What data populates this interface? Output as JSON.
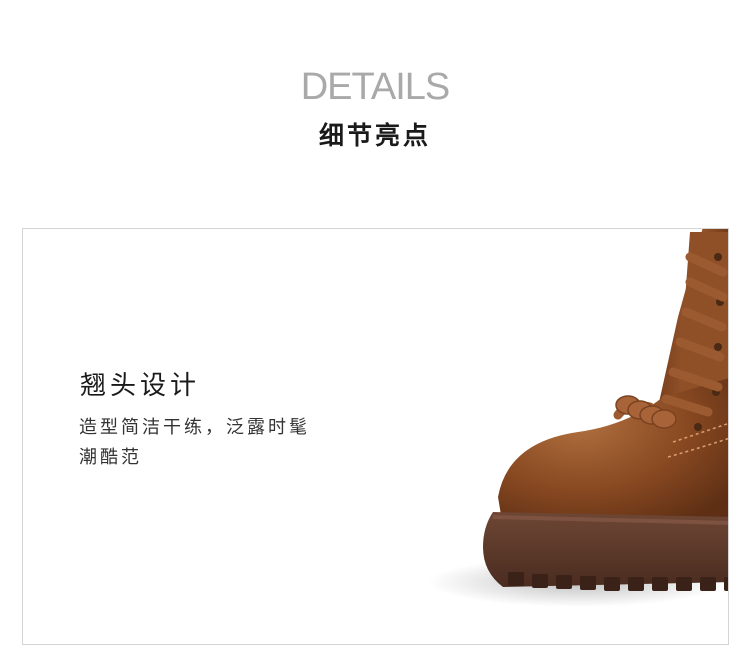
{
  "header": {
    "title_en": "DETAILS",
    "title_cn": "细节亮点"
  },
  "feature": {
    "title": "翘头设计",
    "description": "造型简洁干练，泛露时髦\n潮酷范"
  },
  "image": {
    "subject": "brown-lace-up-boot",
    "colors": {
      "leather": "#8a4a22",
      "sole": "#5e3a2a",
      "lace": "#9c5a30"
    }
  }
}
